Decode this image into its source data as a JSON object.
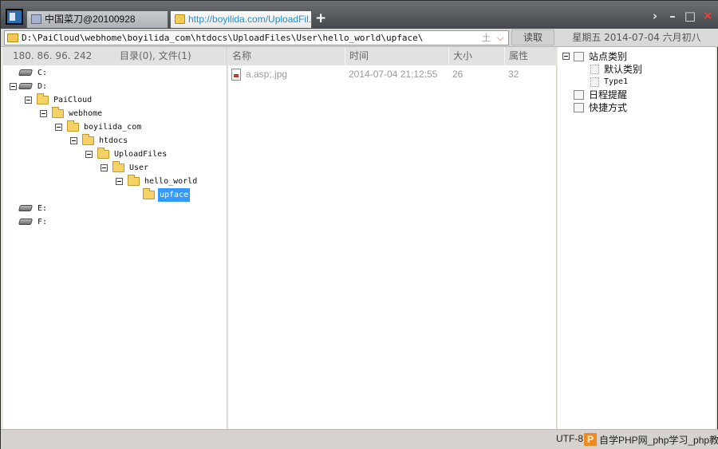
{
  "tabs": [
    {
      "label": "中国菜刀@20100928",
      "active": false
    },
    {
      "label": "http://boyilida.com/UploadFil...",
      "active": true
    }
  ],
  "window_controls": {
    "new_tab": "+",
    "nav": "›",
    "minimize": "–",
    "maximize": "□",
    "close": "✕"
  },
  "address": {
    "path": "D:\\PaiCloud\\webhome\\boyilida_com\\htdocs\\UploadFiles\\User\\hello_world\\upface\\",
    "extra": "土",
    "dropdown": "⌵"
  },
  "read_button": "读取",
  "date_label": "星期五 2014-07-04 六月初八",
  "left_header": {
    "ip": "180. 86. 96. 242",
    "counts": "目录(0), 文件(1)"
  },
  "tree": [
    {
      "label": "C:",
      "type": "drive"
    },
    {
      "label": "D:",
      "type": "drive"
    },
    {
      "label": "PaiCloud",
      "type": "folder"
    },
    {
      "label": "webhome",
      "type": "folder"
    },
    {
      "label": "boyilida_com",
      "type": "folder"
    },
    {
      "label": "htdocs",
      "type": "folder"
    },
    {
      "label": "UploadFiles",
      "type": "folder"
    },
    {
      "label": "User",
      "type": "folder"
    },
    {
      "label": "hello_world",
      "type": "folder"
    },
    {
      "label": "upface",
      "type": "folder",
      "selected": true
    },
    {
      "label": "E:",
      "type": "drive"
    },
    {
      "label": "F:",
      "type": "drive"
    }
  ],
  "columns": {
    "name": "名称",
    "time": "时间",
    "size": "大小",
    "attr": "属性"
  },
  "files": [
    {
      "name": "a.asp;.jpg",
      "time": "2014-07-04 21:12:55",
      "size": "26",
      "attr": "32"
    }
  ],
  "right_tree": {
    "sites": "站点类别",
    "default_category": "默认类别",
    "type1": "Type1",
    "schedule": "日程提醒",
    "shortcuts": "快捷方式"
  },
  "status": {
    "encoding": "UTF-8",
    "watermark_logo": "P",
    "watermark_text": "自学PHP网_php学习_php教"
  },
  "colors": {
    "selection": "#3399ff",
    "active_tab_text": "#1e8fd0",
    "close_button": "#ff3b30"
  }
}
